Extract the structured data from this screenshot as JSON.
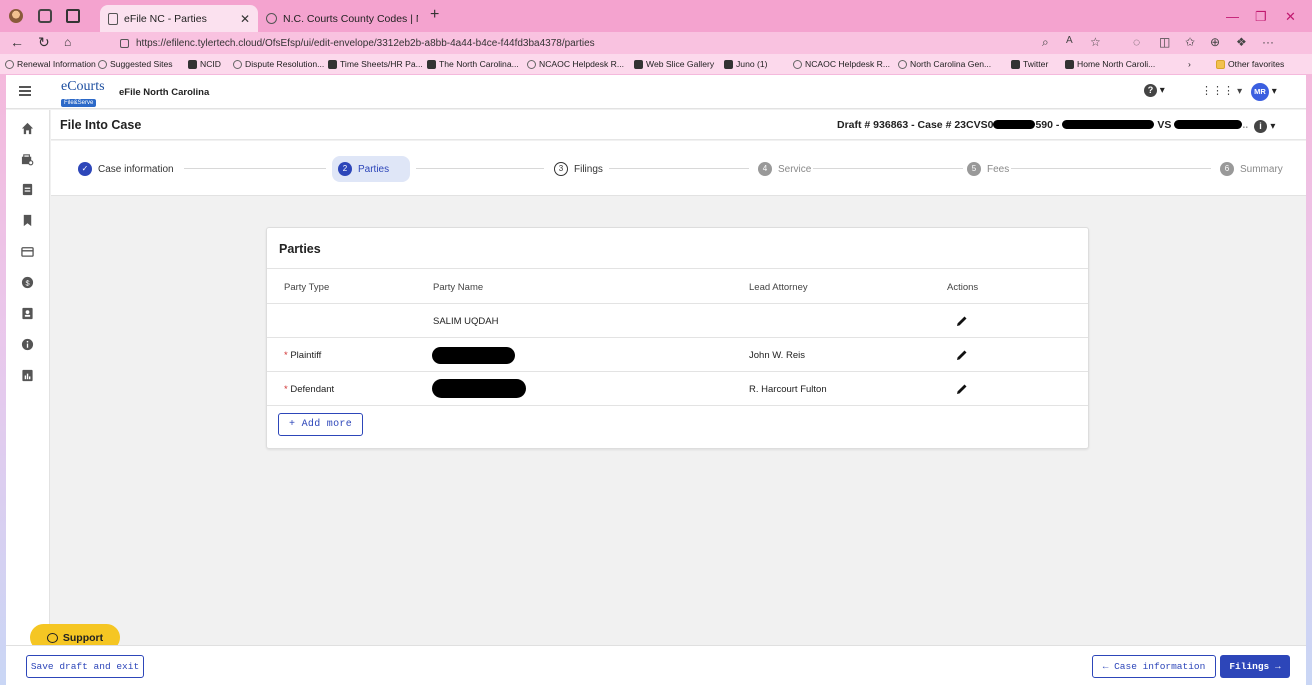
{
  "browser": {
    "tabs": [
      {
        "title": "eFile NC - Parties",
        "active": true
      },
      {
        "title": "N.C. Courts County Codes | Nort",
        "active": false
      }
    ],
    "url": "https://efilenc.tylertech.cloud/OfsEfsp/ui/edit-envelope/3312eb2b-a8bb-4a44-b4ce-f44fd3ba4378/parties",
    "favorites": [
      "Renewal Information",
      "Suggested Sites",
      "NCID",
      "Dispute Resolution...",
      "Time Sheets/HR Pa...",
      "The North Carolina...",
      "NCAOC Helpdesk R...",
      "Web Slice Gallery",
      "Juno (1)",
      "NCAOC Helpdesk R...",
      "North Carolina Gen...",
      "Twitter",
      "Home North Caroli..."
    ],
    "other_favorites": "Other favorites"
  },
  "app": {
    "brand_top": "eCourts",
    "brand_bottom": "File&Serve",
    "name": "eFile North Carolina",
    "avatar_initials": "MR"
  },
  "page": {
    "title": "File Into Case",
    "case_prefix": "Draft # 936863 - Case # 23CVS0",
    "case_mid": "590 -",
    "case_vs": "VS"
  },
  "stepper": [
    {
      "num": "",
      "label": "Case information"
    },
    {
      "num": "2",
      "label": "Parties"
    },
    {
      "num": "3",
      "label": "Filings"
    },
    {
      "num": "4",
      "label": "Service"
    },
    {
      "num": "5",
      "label": "Fees"
    },
    {
      "num": "6",
      "label": "Summary"
    }
  ],
  "parties": {
    "title": "Parties",
    "columns": [
      "Party Type",
      "Party Name",
      "Lead Attorney",
      "Actions"
    ],
    "rows": [
      {
        "type": "",
        "name": "SALIM UQDAH",
        "attorney": ""
      },
      {
        "type": "Plaintiff",
        "name": "",
        "attorney": "John W. Reis"
      },
      {
        "type": "Defendant",
        "name": "",
        "attorney": "R. Harcourt Fulton"
      }
    ],
    "add_more": "+ Add more"
  },
  "footer": {
    "support": "Support",
    "save_draft": "Save draft and exit",
    "back": "← Case information",
    "next": "Filings →"
  },
  "colors": {
    "primary": "#2d46b9",
    "support": "#f5c623",
    "browser_chrome": "#f4a3cf"
  }
}
